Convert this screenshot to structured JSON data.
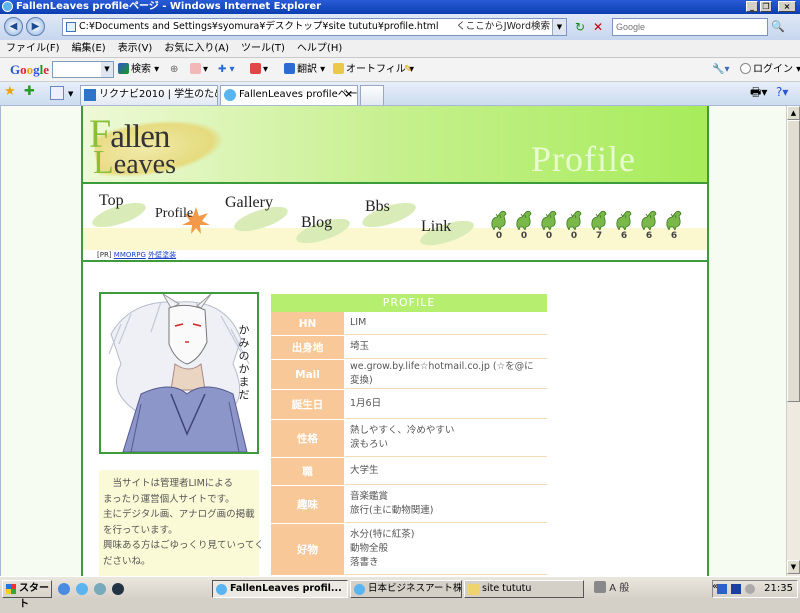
{
  "window": {
    "title": "FallenLeaves profileページ - Windows Internet Explorer",
    "min": "_",
    "max": "❐",
    "close": "×"
  },
  "address": {
    "back": "◀",
    "forward": "▶",
    "url": "C:¥Documents and Settings¥syomura¥デスクトップ¥site tututu¥profile.html",
    "jword": "くここからJWord検索",
    "dropdown": "▼",
    "refresh": "↻",
    "stop": "✕",
    "search_placeholder": "Google",
    "search_button": "🔍"
  },
  "menu": [
    "ファイル(F)",
    "編集(E)",
    "表示(V)",
    "お気に入り(A)",
    "ツール(T)",
    "ヘルプ(H)"
  ],
  "google_toolbar": {
    "logo": "Google",
    "dropdown": "▼",
    "search": "検索",
    "translate": "翻訳",
    "autofill": "オートフィル",
    "login": "ログイン"
  },
  "tabs": [
    {
      "label": "リクナビ2010 | 学生のための...",
      "active": false
    },
    {
      "label": "FallenLeaves profileペー...",
      "active": true
    }
  ],
  "site": {
    "logo_f": "F",
    "logo_rest1": "allen",
    "logo_l": "L",
    "logo_rest2": "eaves",
    "banner_word": "Profile",
    "nav": [
      "Top",
      "Profile",
      "Gallery",
      "Blog",
      "Bbs",
      "Link"
    ],
    "counter": [
      "0",
      "0",
      "0",
      "0",
      "7",
      "6",
      "6",
      "6"
    ],
    "pr_prefix": "[PR]",
    "pr_link1": "MMORPG",
    "pr_link2": "外壁塗装",
    "portrait_text": "かみのかまだ",
    "intro": [
      "　当サイトは管理者LIMによる",
      "まったり運営個人サイトです。",
      "主にデジタル画、アナログ画の掲載",
      "を行っています。",
      "興味ある方はごゆっくり見ていってく",
      "ださいね。"
    ],
    "profile": {
      "heading": "PROFILE",
      "rows": [
        {
          "key": "HN",
          "values": [
            "LIM"
          ]
        },
        {
          "key": "出身地",
          "values": [
            "埼玉"
          ]
        },
        {
          "key": "Mail",
          "values": [
            "we.grow.by.life☆hotmail.co.jp (☆を@に変換)"
          ]
        },
        {
          "key": "誕生日",
          "values": [
            "1月6日"
          ]
        },
        {
          "key": "性格",
          "values": [
            "熱しやすく、冷めやすい",
            "涙もろい"
          ]
        },
        {
          "key": "職",
          "values": [
            "大学生"
          ]
        },
        {
          "key": "趣味",
          "values": [
            "音楽鑑賞",
            "旅行(主に動物関連)"
          ]
        },
        {
          "key": "好物",
          "values": [
            "水分(特に紅茶)",
            "動物全般",
            "落書き"
          ]
        }
      ]
    }
  },
  "taskbar": {
    "start": "スタート",
    "windows": [
      {
        "label": "FallenLeaves profil...",
        "active": true
      },
      {
        "label": "日本ビジネスアート株式会...",
        "active": false
      },
      {
        "label": "site tututu",
        "active": false
      }
    ],
    "ime": "A 般",
    "clock": "21:35",
    "expand": "«"
  },
  "colors": {
    "site_border": "#3c9c3c",
    "banner_green": "#a7ec5a",
    "profile_head": "#b6ef6f",
    "profile_key": "#f8c898",
    "intro_bg": "#fbfad6"
  }
}
